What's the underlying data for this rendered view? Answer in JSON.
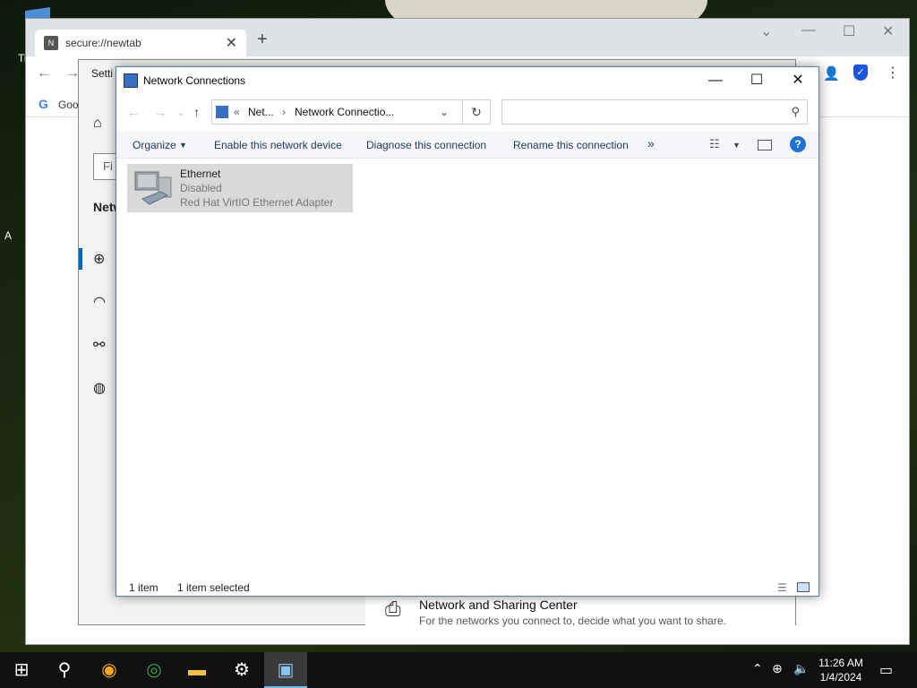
{
  "browser": {
    "tab_title": "secure://newtab",
    "tab_favicon_letter": "N",
    "bookmark_stub": "Goo",
    "left_edge_text": [
      "Ti",
      "A"
    ]
  },
  "settings": {
    "title": "Setti",
    "find_placeholder": "Fi",
    "section_heading": "Netw",
    "sharing_center": {
      "title": "Network and Sharing Center",
      "description": "For the networks you connect to, decide what you want to share."
    }
  },
  "explorer": {
    "title": "Network Connections",
    "address": {
      "prefix": "«",
      "segment1": "Net...",
      "sep": "›",
      "segment2": "Network Connectio..."
    },
    "search_placeholder": "",
    "commands": {
      "organize": "Organize",
      "enable": "Enable this network device",
      "diagnose": "Diagnose this connection",
      "rename": "Rename this connection",
      "more": "»"
    },
    "items": [
      {
        "name": "Ethernet",
        "status": "Disabled",
        "adapter": "Red Hat VirtIO Ethernet Adapter"
      }
    ],
    "status_bar": {
      "count": "1 item",
      "selected": "1 item selected"
    }
  },
  "taskbar": {
    "time": "11:26 AM",
    "date": "1/4/2024"
  },
  "colors": {
    "accent": "#0067c0",
    "selection": "#d9d9d9",
    "taskbar": "#101010",
    "help_icon": "#1e73d2",
    "shield_icon": "#1a56db"
  }
}
